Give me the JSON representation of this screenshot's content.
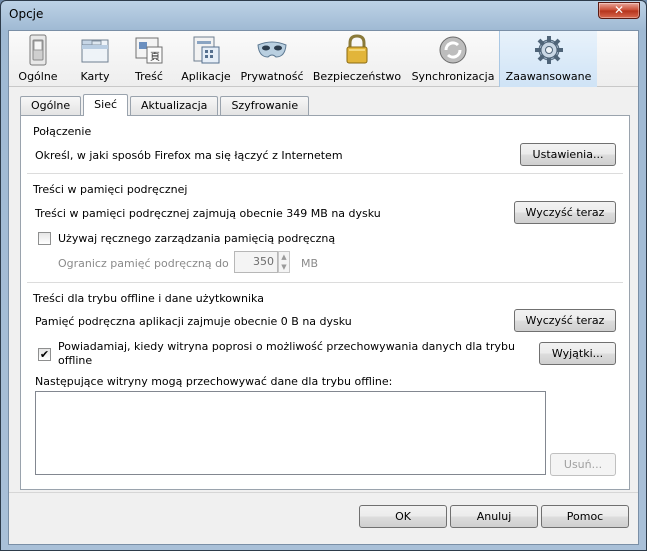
{
  "window": {
    "title": "Opcje",
    "close_label": "✕"
  },
  "toolbar": {
    "items": [
      {
        "label": "Ogólne"
      },
      {
        "label": "Karty"
      },
      {
        "label": "Treść"
      },
      {
        "label": "Aplikacje"
      },
      {
        "label": "Prywatność"
      },
      {
        "label": "Bezpieczeństwo"
      },
      {
        "label": "Synchronizacja"
      },
      {
        "label": "Zaawansowane"
      }
    ],
    "active": "Zaawansowane"
  },
  "tabs": {
    "items": [
      {
        "label": "Ogólne"
      },
      {
        "label": "Sieć"
      },
      {
        "label": "Aktualizacja"
      },
      {
        "label": "Szyfrowanie"
      }
    ],
    "active": "Sieć"
  },
  "connection": {
    "title": "Połączenie",
    "description": "Określ, w jaki sposób Firefox ma się łączyć z Internetem",
    "settings_button": "Ustawienia..."
  },
  "cache": {
    "title": "Treści w pamięci podręcznej",
    "status": "Treści w pamięci podręcznej zajmują obecnie 349 MB na dysku",
    "clear_button": "Wyczyść teraz",
    "override_label": "Używaj ręcznego zarządzania pamięcią podręczną",
    "override_checked": false,
    "limit_label": "Ogranicz pamięć podręczną do",
    "limit_value": "350",
    "limit_unit": "MB"
  },
  "offline": {
    "title": "Treści dla trybu offline i dane użytkownika",
    "status": "Pamięć podręczna aplikacji zajmuje obecnie 0 B na dysku",
    "clear_button": "Wyczyść teraz",
    "notify_label_line1": "Powiadamiaj, kiedy witryna poprosi o możliwość przechowywania danych dla trybu",
    "notify_label_line2": "offline",
    "notify_checked": true,
    "exceptions_button": "Wyjątki...",
    "sites_label": "Następujące witryny mogą przechowywać dane dla trybu offline:",
    "remove_button": "Usuń..."
  },
  "footer": {
    "ok": "OK",
    "cancel": "Anuluj",
    "help": "Pomoc"
  }
}
